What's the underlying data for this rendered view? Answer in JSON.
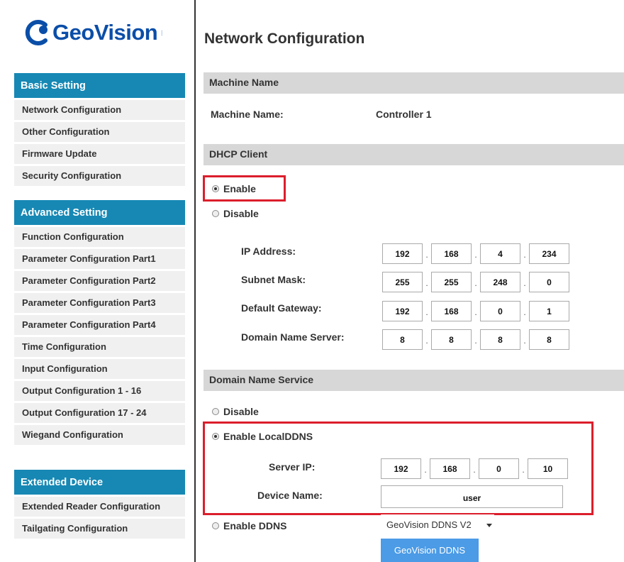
{
  "logo": {
    "text": "GeoVision"
  },
  "sidebar": {
    "basic": {
      "title": "Basic Setting",
      "items": [
        "Network Configuration",
        "Other Configuration",
        "Firmware Update",
        "Security Configuration"
      ]
    },
    "advanced": {
      "title": "Advanced Setting",
      "items": [
        "Function Configuration",
        "Parameter Configuration Part1",
        "Parameter Configuration Part2",
        "Parameter Configuration Part3",
        "Parameter Configuration Part4",
        "Time Configuration",
        "Input Configuration",
        "Output Configuration 1 - 16",
        "Output Configuration 17 - 24",
        "Wiegand Configuration"
      ]
    },
    "extended": {
      "title": "Extended Device",
      "items": [
        "Extended Reader Configuration",
        "Tailgating Configuration"
      ]
    }
  },
  "main": {
    "title": "Network Configuration",
    "machine": {
      "section": "Machine Name",
      "label": "Machine Name:",
      "value": "Controller 1"
    },
    "dhcp": {
      "section": "DHCP Client",
      "enable": "Enable",
      "disable": "Disable",
      "selected": "enable",
      "fields": [
        {
          "label": "IP Address:",
          "octets": [
            "192",
            "168",
            "4",
            "234"
          ]
        },
        {
          "label": "Subnet Mask:",
          "octets": [
            "255",
            "255",
            "248",
            "0"
          ]
        },
        {
          "label": "Default Gateway:",
          "octets": [
            "192",
            "168",
            "0",
            "1"
          ]
        },
        {
          "label": "Domain Name Server:",
          "octets": [
            "8",
            "8",
            "8",
            "8"
          ]
        }
      ]
    },
    "dns": {
      "section": "Domain Name Service",
      "disable": "Disable",
      "local": "Enable LocalDDNS",
      "selected": "local",
      "server_ip_label": "Server IP:",
      "server_ip": [
        "192",
        "168",
        "0",
        "10"
      ],
      "device_name_label": "Device Name:",
      "device_name": "user",
      "ddns": "Enable DDNS",
      "ddns_selected": "GeoVision DDNS V2",
      "ddns_button": "GeoVision DDNS"
    }
  },
  "colors": {
    "sidebar_header": "#1788b4",
    "highlight_border": "#dc1e2c",
    "primary_button": "#4b9be6",
    "logo_blue": "#0a4ea8"
  }
}
